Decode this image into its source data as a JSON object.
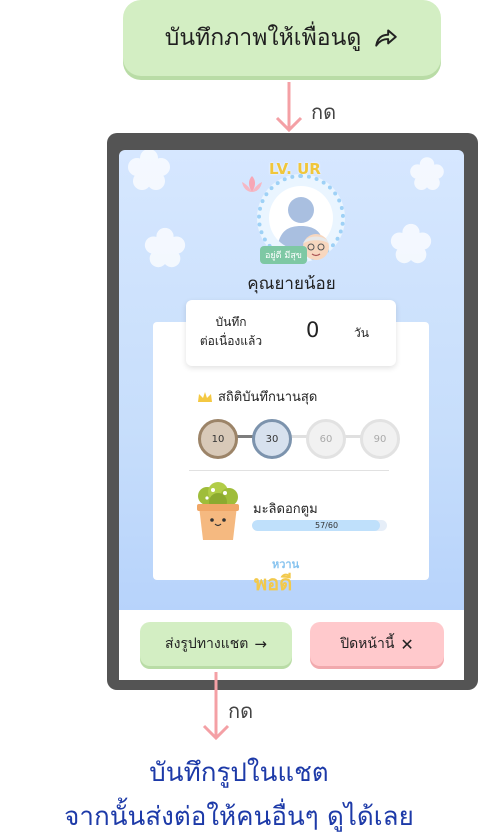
{
  "top_button": {
    "label": "บันทึกภาพให้เพื่อนดู",
    "icon": "share-arrow-icon"
  },
  "press_label_top": "กด",
  "press_label_bottom": "กด",
  "profile": {
    "level": "LV. UR",
    "name_tag": "อยู่ดี มีสุข",
    "user_name": "คุณยายน้อย"
  },
  "streak": {
    "label": "บันทึก\nต่อเนื่องแล้ว",
    "value": "0",
    "unit": "วัน"
  },
  "stats": {
    "title": "สถิติบันทึกนานสุด",
    "badges": [
      {
        "label": "10",
        "achieved": true
      },
      {
        "label": "30",
        "achieved": true
      },
      {
        "label": "60",
        "achieved": false
      },
      {
        "label": "90",
        "achieved": false
      }
    ]
  },
  "plant": {
    "name": "มะลิดอกตูม",
    "progress_text": "57/60",
    "progress": 0.95
  },
  "logo": {
    "top": "หวาน",
    "bottom": "พอดี"
  },
  "buttons": {
    "share": "ส่งรูปทางแชต",
    "close": "ปิดหน้านี้"
  },
  "caption": {
    "line1": "บันทึกรูปในแชต",
    "line2": "จากนั้นส่งต่อให้คนอื่นๆ ดูได้เลย"
  },
  "colors": {
    "caption": "#1d3aa8",
    "share_button": "#d3eec3",
    "close_button": "#ffc9cc",
    "arrow": "#f4a0a5"
  }
}
